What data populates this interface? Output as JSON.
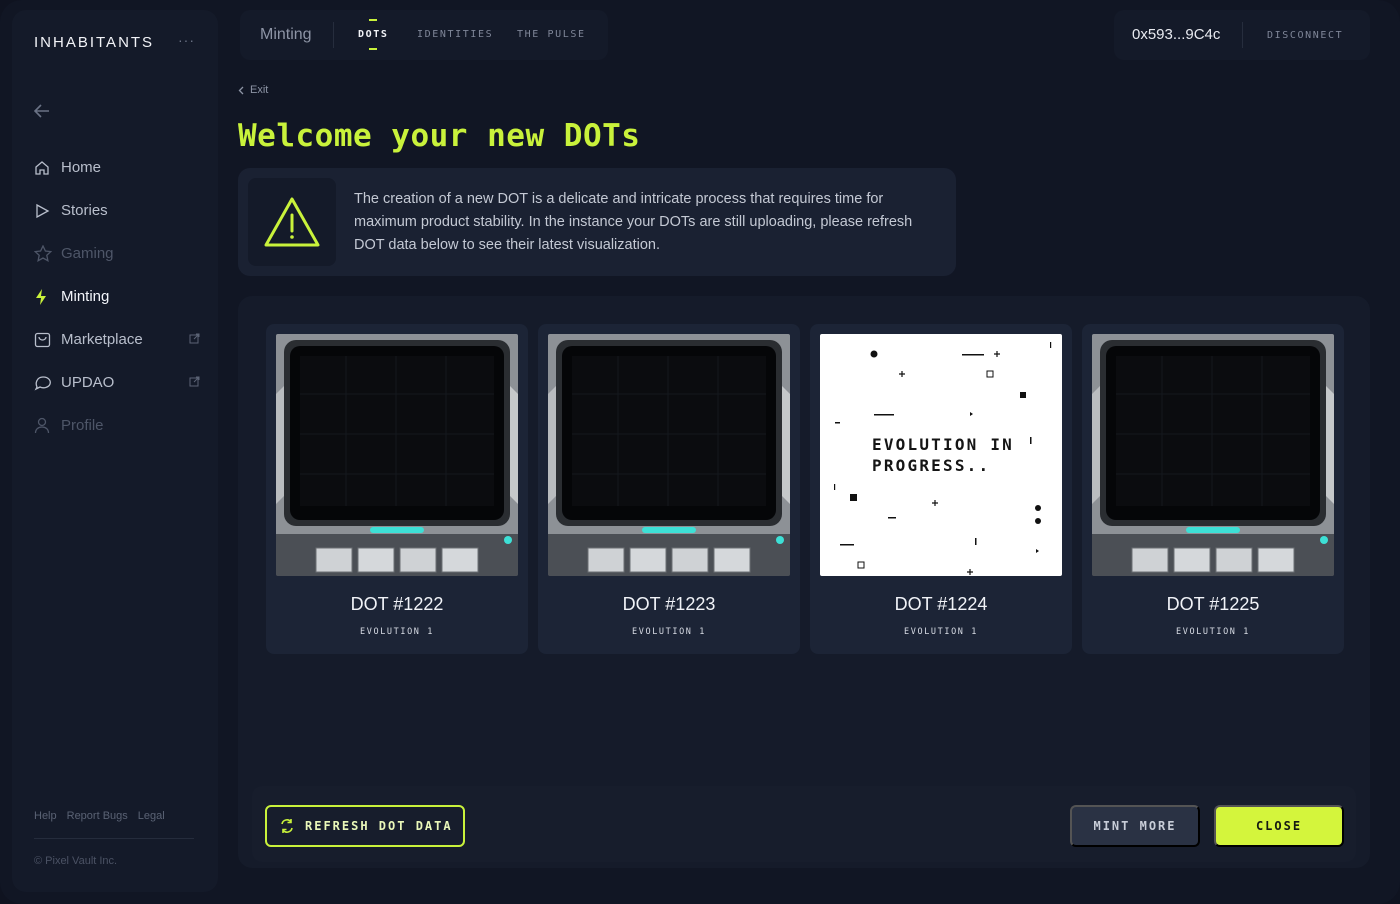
{
  "app": {
    "logo": "INHABITANTS",
    "more_icon": "more-horizontal-icon"
  },
  "sidebar": {
    "items": [
      {
        "label": "Home",
        "icon": "home-icon"
      },
      {
        "label": "Stories",
        "icon": "play-icon"
      },
      {
        "label": "Gaming",
        "icon": "star-icon"
      },
      {
        "label": "Minting",
        "icon": "bolt-icon",
        "active": true
      },
      {
        "label": "Marketplace",
        "icon": "marketplace-icon",
        "external": true
      },
      {
        "label": "UPDAO",
        "icon": "chat-icon",
        "external": true
      },
      {
        "label": "Profile",
        "icon": "user-icon"
      }
    ],
    "footer_links": [
      "Help",
      "Report Bugs",
      "Legal"
    ],
    "copyright": "© Pixel Vault Inc."
  },
  "topbar": {
    "section": "Minting",
    "tabs": [
      {
        "label": "DOTS",
        "active": true
      },
      {
        "label": "IDENTITIES"
      },
      {
        "label": "THE PULSE"
      }
    ]
  },
  "wallet": {
    "address": "0x593...9C4c",
    "disconnect_label": "DISCONNECT"
  },
  "main": {
    "exit_label": "Exit",
    "title": "Welcome your new DOTs",
    "notice": "The creation of a new DOT is a delicate and intricate process that requires time for maximum product stability. In the instance your DOTs are still uploading, please refresh DOT data below to see their latest visualization."
  },
  "dots": [
    {
      "name": "DOT #1222",
      "evolution": "EVOLUTION 1",
      "state": "ready"
    },
    {
      "name": "DOT #1223",
      "evolution": "EVOLUTION 1",
      "state": "ready"
    },
    {
      "name": "DOT #1224",
      "evolution": "EVOLUTION 1",
      "state": "in-progress",
      "progress_text": "EVOLUTION IN PROGRESS.."
    },
    {
      "name": "DOT #1225",
      "evolution": "EVOLUTION 1",
      "state": "ready"
    }
  ],
  "actions": {
    "refresh_label": "REFRESH DOT DATA",
    "mint_more_label": "MINT MORE",
    "close_label": "CLOSE"
  },
  "colors": {
    "accent": "#c9f23b",
    "background": "#111624",
    "panel": "#151b2a",
    "card": "#1c2436"
  }
}
